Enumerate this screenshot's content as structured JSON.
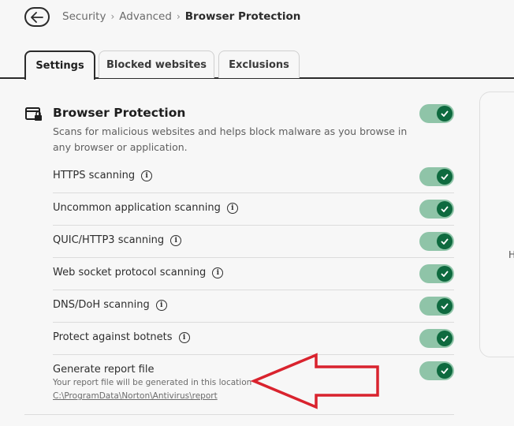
{
  "header": {
    "breadcrumb": [
      "Security",
      "Advanced",
      "Browser Protection"
    ]
  },
  "tabs": [
    {
      "label": "Settings",
      "active": true
    },
    {
      "label": "Blocked websites",
      "active": false
    },
    {
      "label": "Exclusions",
      "active": false
    }
  ],
  "section": {
    "title": "Browser Protection",
    "description": "Scans for malicious websites and helps block malware as you browse in any browser or application.",
    "enabled": true
  },
  "settings": [
    {
      "label": "HTTPS scanning",
      "info": true,
      "enabled": true
    },
    {
      "label": "Uncommon application scanning",
      "info": true,
      "enabled": true
    },
    {
      "label": "QUIC/HTTP3 scanning",
      "info": true,
      "enabled": true
    },
    {
      "label": "Web socket protocol scanning",
      "info": true,
      "enabled": true
    },
    {
      "label": "DNS/DoH scanning",
      "info": true,
      "enabled": true
    },
    {
      "label": "Protect against botnets",
      "info": true,
      "enabled": true
    }
  ],
  "report": {
    "label": "Generate report file",
    "subtitle": "Your report file will be generated in this location",
    "path": "C:\\ProgramData\\Norton\\Antivirus\\report",
    "enabled": true
  },
  "side_card": {
    "partial_text": "H"
  },
  "colors": {
    "toggle_track": "#8fc4a8",
    "toggle_knob": "#0e6a3f",
    "annotation_arrow": "#d9232e"
  },
  "icons": {
    "back": "arrow-left-icon",
    "section": "browser-lock-icon",
    "info": "info-icon",
    "toggle_check": "check-icon"
  }
}
